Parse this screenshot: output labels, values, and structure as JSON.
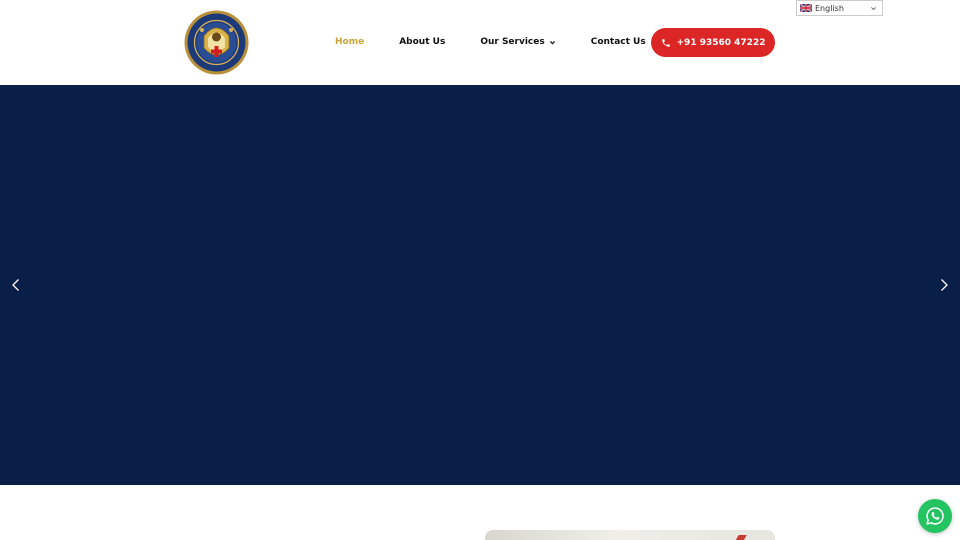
{
  "header": {
    "logo_alt": "",
    "nav": [
      {
        "label": "Home",
        "active": true
      },
      {
        "label": "About Us",
        "active": false
      },
      {
        "label": "Our Services",
        "active": false,
        "has_dropdown": true
      },
      {
        "label": "Contact Us",
        "active": false
      }
    ],
    "phone_label": "+91 93560 47222",
    "language": {
      "selected": "English",
      "flag": "uk-flag-icon"
    }
  },
  "hero": {
    "background_color": "#0a1f47",
    "prev_icon": "chevron-left-icon",
    "next_icon": "chevron-right-icon"
  },
  "colors": {
    "accent_active_nav": "#c9a43a",
    "call_button": "#dc2626",
    "whatsapp": "#25c463"
  },
  "floating": {
    "whatsapp_icon": "whatsapp-icon"
  }
}
